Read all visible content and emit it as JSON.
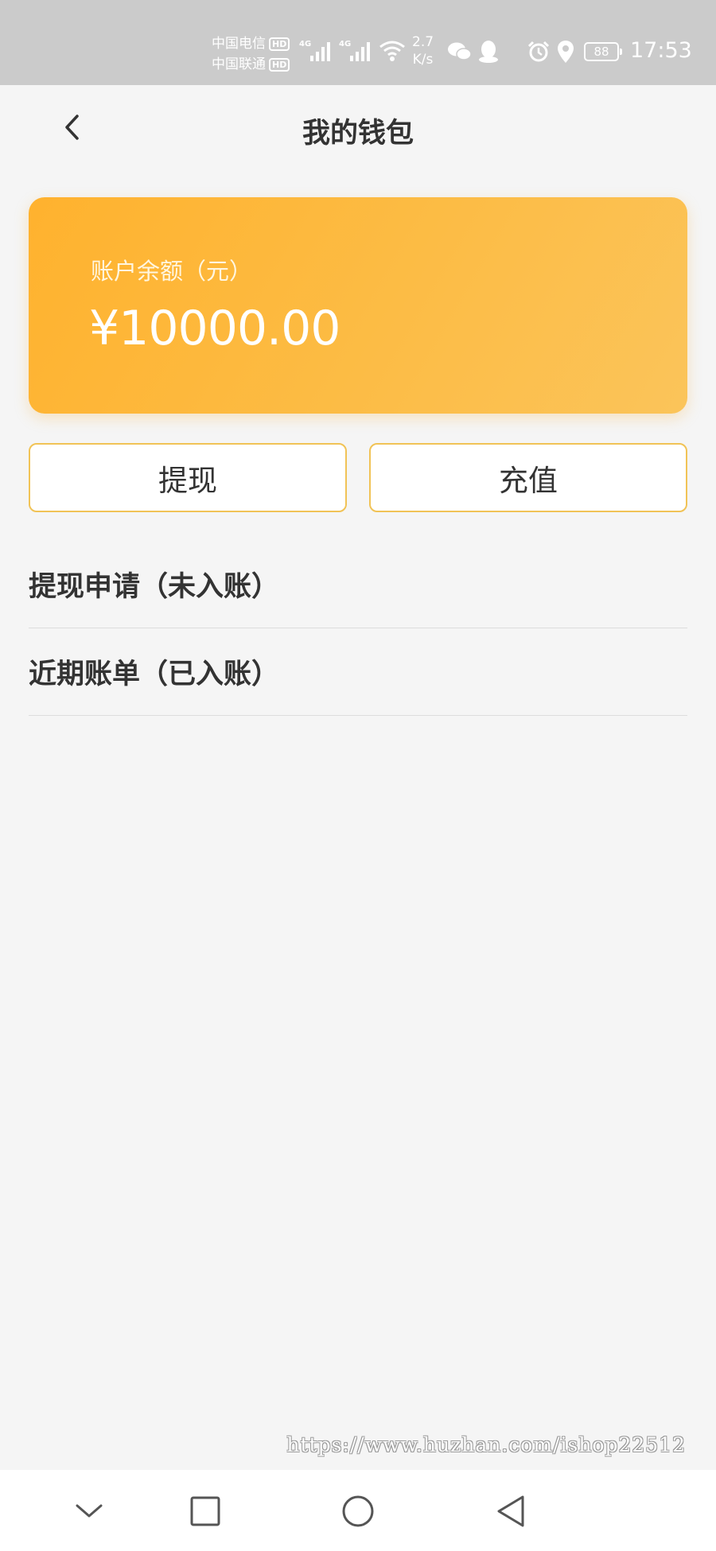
{
  "status_bar": {
    "carrier_1": "中国电信",
    "carrier_2": "中国联通",
    "hd_label": "HD",
    "network_1": "4G",
    "network_2": "4G",
    "speed_value": "2.7",
    "speed_unit": "K/s",
    "battery": "88",
    "time": "17:53",
    "icons": [
      "signal-icon",
      "signal-icon",
      "wifi-icon",
      "wechat-icon",
      "qq-icon",
      "alarm-icon",
      "location-icon",
      "battery-icon"
    ]
  },
  "header": {
    "title": "我的钱包",
    "back_icon": "chevron-left-icon"
  },
  "balance_card": {
    "label": "账户余额（元）",
    "amount": "¥10000.00",
    "accent_color": "#fbb539"
  },
  "actions": {
    "withdraw_label": "提现",
    "recharge_label": "充值",
    "border_color": "#f1c356"
  },
  "list": {
    "items": [
      {
        "label": "提现申请（未入账）"
      },
      {
        "label": "近期账单（已入账）"
      }
    ]
  },
  "watermark": {
    "text": "https://www.huzhan.com/ishop22512"
  },
  "nav_bar": {
    "icons": [
      "chevron-down-icon",
      "square-icon",
      "circle-icon",
      "triangle-back-icon"
    ]
  }
}
